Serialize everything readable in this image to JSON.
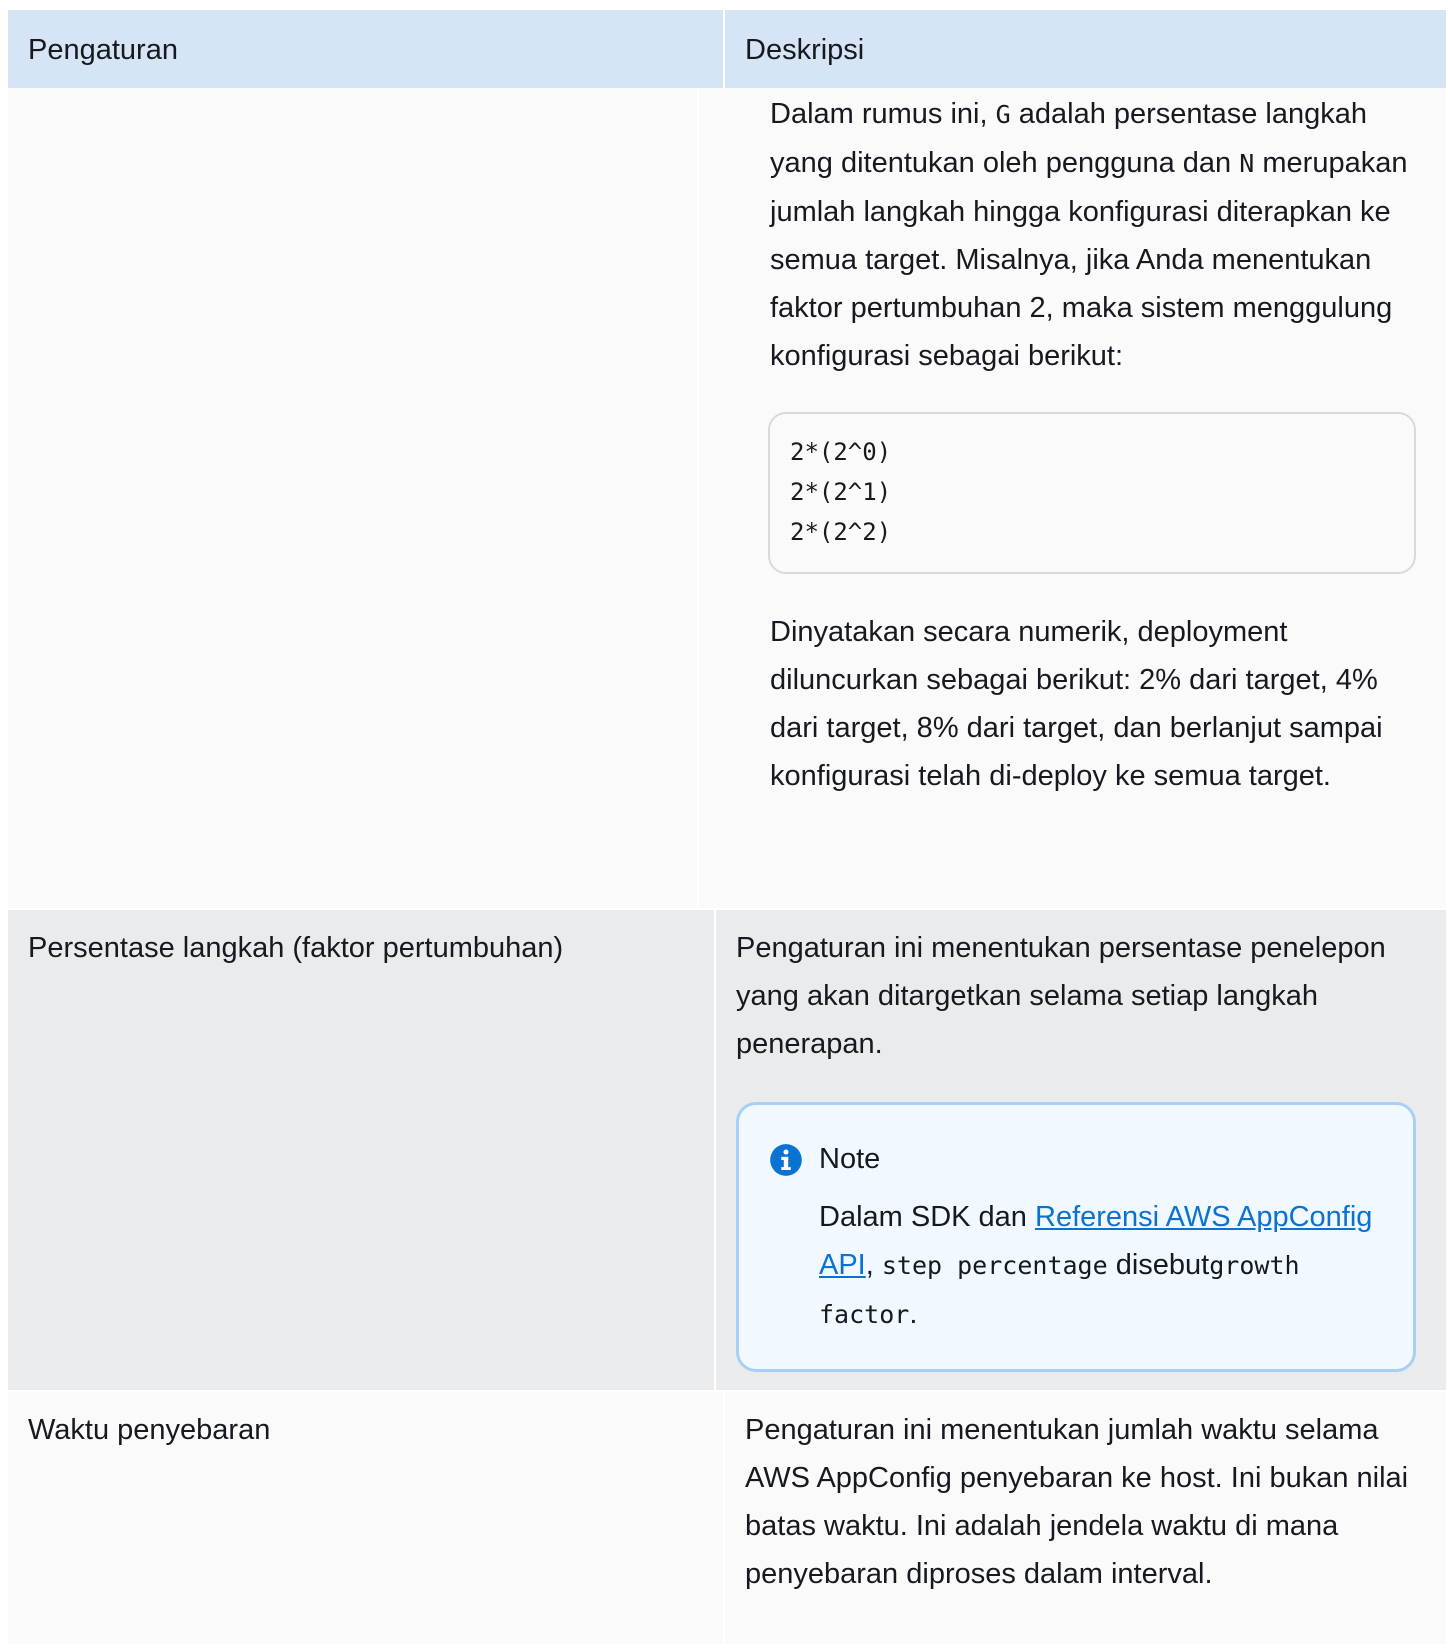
{
  "header": {
    "col_setting": "Pengaturan",
    "col_description": "Deskripsi"
  },
  "row1": {
    "setting": "",
    "para1_a": "Dalam rumus ini, ",
    "para1_code_g": "G",
    "para1_b": " adalah persentase langkah yang ditentukan oleh pengguna dan ",
    "para1_code_n": "N",
    "para1_c": " merupakan jumlah langkah hingga konfigurasi diterapkan ke semua target. Misalnya, jika Anda menentukan faktor pertumbuhan 2, maka sistem menggulung konfigurasi sebagai berikut:",
    "code_block": "2*(2^0)\n2*(2^1)\n2*(2^2)",
    "para2": "Dinyatakan secara numerik, deployment diluncurkan sebagai berikut: 2% dari target, 4% dari target, 8% dari target, dan berlanjut sampai konfigurasi telah di-deploy ke semua target."
  },
  "row2": {
    "setting": "Persentase langkah (faktor pertumbuhan)",
    "description": "Pengaturan ini menentukan persentase penelepon yang akan ditargetkan selama setiap langkah penerapan.",
    "note": {
      "icon": "info-circle-icon",
      "title": "Note",
      "text_a": "Dalam SDK dan ",
      "link": "Referensi AWS AppConfig API",
      "text_b": ", ",
      "code1": "step percentage",
      "text_c": " disebut",
      "code2": "growth factor",
      "text_d": "."
    }
  },
  "row3": {
    "setting": "Waktu penyebaran",
    "description": "Pengaturan ini menentukan jumlah waktu selama AWS AppConfig penyebaran ke host. Ini bukan nilai batas waktu. Ini adalah jendela waktu di mana penyebaran diproses dalam interval."
  },
  "colors": {
    "header_bg": "#d5e5f5",
    "link": "#0972d3",
    "note_bg": "#f1f8ff",
    "note_border": "#a8d0f5"
  }
}
